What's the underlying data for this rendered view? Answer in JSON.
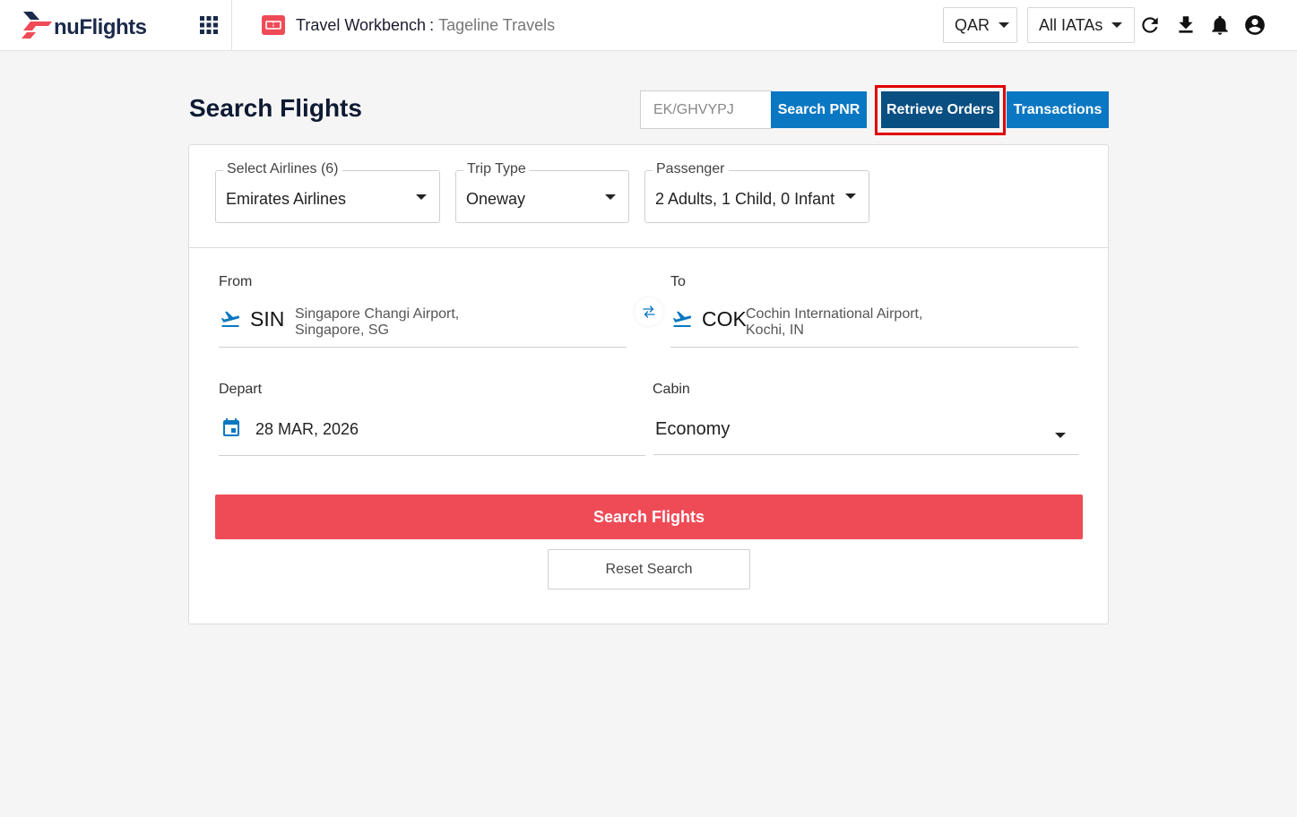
{
  "header": {
    "brand": "nuFlights",
    "workbench_title": "Travel Workbench",
    "separator": ":",
    "agency_name": "Tageline Travels",
    "currency": "QAR",
    "iata_filter": "All IATAs",
    "icons": [
      "apps-grid-icon",
      "workbench-ticket-icon",
      "refresh-icon",
      "download-icon",
      "bell-icon",
      "account-circle-icon"
    ]
  },
  "page": {
    "title": "Search Flights",
    "pnr_placeholder": "EK/GHVYPJ",
    "search_pnr_label": "Search PNR",
    "retrieve_orders_label": "Retrieve Orders",
    "transactions_label": "Transactions"
  },
  "filters": {
    "airlines_label": "Select Airlines (6)",
    "airlines_value": "Emirates Airlines",
    "trip_type_label": "Trip Type",
    "trip_type_value": "Oneway",
    "passenger_label": "Passenger",
    "passenger_value": "2 Adults, 1 Child, 0 Infant"
  },
  "route": {
    "from_label": "From",
    "from_code": "SIN",
    "from_name_line1": "Singapore Changi Airport,",
    "from_name_line2": "Singapore, SG",
    "to_label": "To",
    "to_code": "COK",
    "to_name_line1": "Cochin International Airport,",
    "to_name_line2": "Kochi, IN"
  },
  "schedule": {
    "depart_label": "Depart",
    "depart_value": "28 MAR, 2026",
    "cabin_label": "Cabin",
    "cabin_value": "Economy"
  },
  "actions": {
    "search_label": "Search Flights",
    "reset_label": "Reset Search"
  },
  "colors": {
    "primary_blue": "#0a77c2",
    "navy_button": "#0a4f82",
    "search_red": "#ef4b57",
    "highlight_red": "#e00000",
    "title_navy": "#0f1b33"
  }
}
